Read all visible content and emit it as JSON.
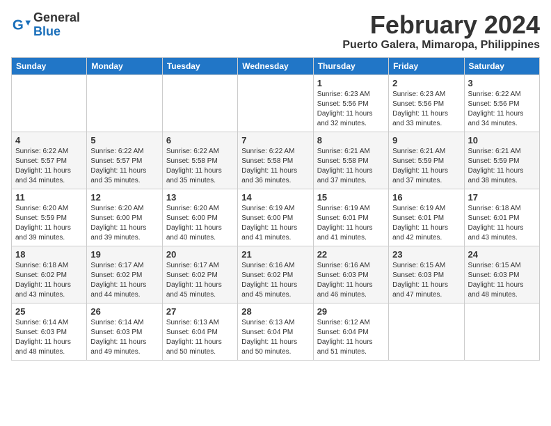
{
  "logo": {
    "line1": "General",
    "line2": "Blue"
  },
  "title": "February 2024",
  "subtitle": "Puerto Galera, Mimaropa, Philippines",
  "weekdays": [
    "Sunday",
    "Monday",
    "Tuesday",
    "Wednesday",
    "Thursday",
    "Friday",
    "Saturday"
  ],
  "weeks": [
    [
      {
        "day": "",
        "info": ""
      },
      {
        "day": "",
        "info": ""
      },
      {
        "day": "",
        "info": ""
      },
      {
        "day": "",
        "info": ""
      },
      {
        "day": "1",
        "info": "Sunrise: 6:23 AM\nSunset: 5:56 PM\nDaylight: 11 hours and 32 minutes."
      },
      {
        "day": "2",
        "info": "Sunrise: 6:23 AM\nSunset: 5:56 PM\nDaylight: 11 hours and 33 minutes."
      },
      {
        "day": "3",
        "info": "Sunrise: 6:22 AM\nSunset: 5:56 PM\nDaylight: 11 hours and 34 minutes."
      }
    ],
    [
      {
        "day": "4",
        "info": "Sunrise: 6:22 AM\nSunset: 5:57 PM\nDaylight: 11 hours and 34 minutes."
      },
      {
        "day": "5",
        "info": "Sunrise: 6:22 AM\nSunset: 5:57 PM\nDaylight: 11 hours and 35 minutes."
      },
      {
        "day": "6",
        "info": "Sunrise: 6:22 AM\nSunset: 5:58 PM\nDaylight: 11 hours and 35 minutes."
      },
      {
        "day": "7",
        "info": "Sunrise: 6:22 AM\nSunset: 5:58 PM\nDaylight: 11 hours and 36 minutes."
      },
      {
        "day": "8",
        "info": "Sunrise: 6:21 AM\nSunset: 5:58 PM\nDaylight: 11 hours and 37 minutes."
      },
      {
        "day": "9",
        "info": "Sunrise: 6:21 AM\nSunset: 5:59 PM\nDaylight: 11 hours and 37 minutes."
      },
      {
        "day": "10",
        "info": "Sunrise: 6:21 AM\nSunset: 5:59 PM\nDaylight: 11 hours and 38 minutes."
      }
    ],
    [
      {
        "day": "11",
        "info": "Sunrise: 6:20 AM\nSunset: 5:59 PM\nDaylight: 11 hours and 39 minutes."
      },
      {
        "day": "12",
        "info": "Sunrise: 6:20 AM\nSunset: 6:00 PM\nDaylight: 11 hours and 39 minutes."
      },
      {
        "day": "13",
        "info": "Sunrise: 6:20 AM\nSunset: 6:00 PM\nDaylight: 11 hours and 40 minutes."
      },
      {
        "day": "14",
        "info": "Sunrise: 6:19 AM\nSunset: 6:00 PM\nDaylight: 11 hours and 41 minutes."
      },
      {
        "day": "15",
        "info": "Sunrise: 6:19 AM\nSunset: 6:01 PM\nDaylight: 11 hours and 41 minutes."
      },
      {
        "day": "16",
        "info": "Sunrise: 6:19 AM\nSunset: 6:01 PM\nDaylight: 11 hours and 42 minutes."
      },
      {
        "day": "17",
        "info": "Sunrise: 6:18 AM\nSunset: 6:01 PM\nDaylight: 11 hours and 43 minutes."
      }
    ],
    [
      {
        "day": "18",
        "info": "Sunrise: 6:18 AM\nSunset: 6:02 PM\nDaylight: 11 hours and 43 minutes."
      },
      {
        "day": "19",
        "info": "Sunrise: 6:17 AM\nSunset: 6:02 PM\nDaylight: 11 hours and 44 minutes."
      },
      {
        "day": "20",
        "info": "Sunrise: 6:17 AM\nSunset: 6:02 PM\nDaylight: 11 hours and 45 minutes."
      },
      {
        "day": "21",
        "info": "Sunrise: 6:16 AM\nSunset: 6:02 PM\nDaylight: 11 hours and 45 minutes."
      },
      {
        "day": "22",
        "info": "Sunrise: 6:16 AM\nSunset: 6:03 PM\nDaylight: 11 hours and 46 minutes."
      },
      {
        "day": "23",
        "info": "Sunrise: 6:15 AM\nSunset: 6:03 PM\nDaylight: 11 hours and 47 minutes."
      },
      {
        "day": "24",
        "info": "Sunrise: 6:15 AM\nSunset: 6:03 PM\nDaylight: 11 hours and 48 minutes."
      }
    ],
    [
      {
        "day": "25",
        "info": "Sunrise: 6:14 AM\nSunset: 6:03 PM\nDaylight: 11 hours and 48 minutes."
      },
      {
        "day": "26",
        "info": "Sunrise: 6:14 AM\nSunset: 6:03 PM\nDaylight: 11 hours and 49 minutes."
      },
      {
        "day": "27",
        "info": "Sunrise: 6:13 AM\nSunset: 6:04 PM\nDaylight: 11 hours and 50 minutes."
      },
      {
        "day": "28",
        "info": "Sunrise: 6:13 AM\nSunset: 6:04 PM\nDaylight: 11 hours and 50 minutes."
      },
      {
        "day": "29",
        "info": "Sunrise: 6:12 AM\nSunset: 6:04 PM\nDaylight: 11 hours and 51 minutes."
      },
      {
        "day": "",
        "info": ""
      },
      {
        "day": "",
        "info": ""
      }
    ]
  ]
}
